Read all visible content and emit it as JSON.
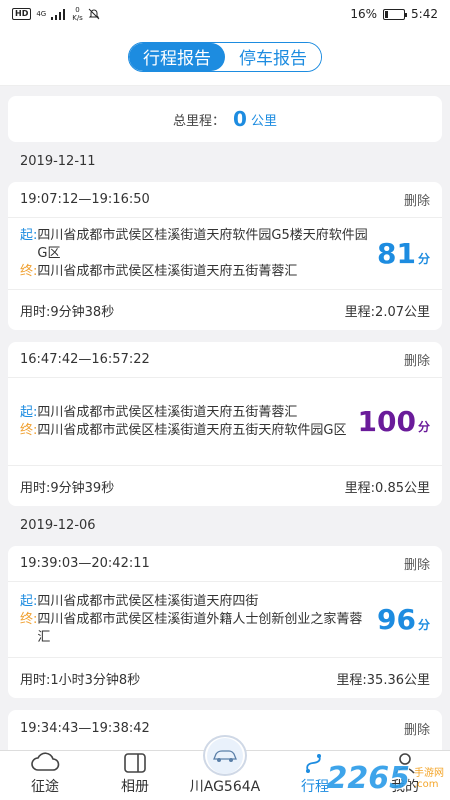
{
  "status_bar": {
    "hd": "HD",
    "network": "4G",
    "speed_value": "0",
    "speed_unit": "K/s",
    "battery_percent": "16%",
    "battery_level": 0.16,
    "time": "5:42"
  },
  "header": {
    "tabs": [
      {
        "label": "行程报告",
        "active": true
      },
      {
        "label": "停车报告",
        "active": false
      }
    ]
  },
  "summary": {
    "label": "总里程：",
    "value": "0",
    "unit": "公里"
  },
  "groups": [
    {
      "date": "2019-12-11",
      "trips": [
        {
          "time_range": "19:07:12—19:16:50",
          "delete_label": "删除",
          "start_mark": "起:",
          "start": "四川省成都市武侯区桂溪街道天府软件园G5楼天府软件园G区",
          "end_mark": "终:",
          "end": "四川省成都市武侯区桂溪街道天府五街菁蓉汇",
          "score": "81",
          "score_unit": "分",
          "duration": "用时:9分钟38秒",
          "distance": "里程:2.07公里"
        },
        {
          "time_range": "16:47:42—16:57:22",
          "delete_label": "删除",
          "start_mark": "起:",
          "start": "四川省成都市武侯区桂溪街道天府五街菁蓉汇",
          "end_mark": "终:",
          "end": "四川省成都市武侯区桂溪街道天府五街天府软件园G区",
          "score": "100",
          "score_unit": "分",
          "duration": "用时:9分钟39秒",
          "distance": "里程:0.85公里"
        }
      ]
    },
    {
      "date": "2019-12-06",
      "trips": [
        {
          "time_range": "19:39:03—20:42:11",
          "delete_label": "删除",
          "start_mark": "起:",
          "start": "四川省成都市武侯区桂溪街道天府四街",
          "end_mark": "终:",
          "end": "四川省成都市武侯区桂溪街道外籍人士创新创业之家菁蓉汇",
          "score": "96",
          "score_unit": "分",
          "duration": "用时:1小时3分钟8秒",
          "distance": "里程:35.36公里"
        },
        {
          "time_range": "19:34:43—19:38:42",
          "delete_label": "删除"
        }
      ]
    }
  ],
  "tabbar": [
    {
      "label": "征途",
      "icon": "cloud-icon",
      "active": false
    },
    {
      "label": "相册",
      "icon": "album-icon",
      "active": false
    },
    {
      "label": "川AG564A",
      "icon": "car-icon",
      "active": false
    },
    {
      "label": "行程",
      "icon": "route-icon",
      "active": true
    },
    {
      "label": "我的",
      "icon": "user-icon",
      "active": false
    }
  ],
  "watermark": {
    "number": "2265",
    "domain": ".com",
    "tagline": "手游网"
  },
  "colors": {
    "accent": "#1d8ce0",
    "score_high": "#6a1b9a",
    "end_marker": "#f0a030"
  }
}
